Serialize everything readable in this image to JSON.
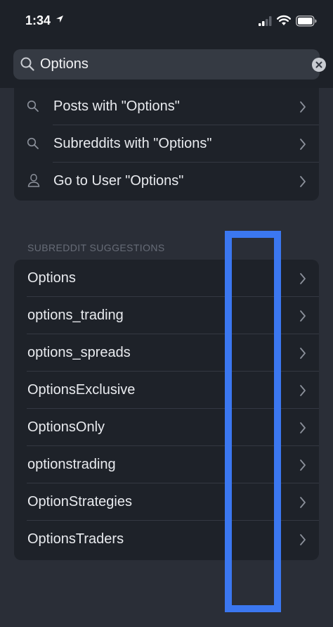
{
  "status_bar": {
    "time": "1:34"
  },
  "search": {
    "value": "Options"
  },
  "search_actions": [
    {
      "label": "Posts with \"Options\"",
      "icon": "search-icon"
    },
    {
      "label": "Subreddits with \"Options\"",
      "icon": "search-icon"
    },
    {
      "label": "Go to User \"Options\"",
      "icon": "user-icon"
    }
  ],
  "suggestions": {
    "header": "SUBREDDIT SUGGESTIONS",
    "items": [
      "Options",
      "options_trading",
      "options_spreads",
      "OptionsExclusive",
      "OptionsOnly",
      "optionstrading",
      "OptionStrategies",
      "OptionsTraders"
    ]
  },
  "colors": {
    "highlight": "#3b77f0",
    "background": "#2a2e37",
    "card": "#1e2229"
  }
}
